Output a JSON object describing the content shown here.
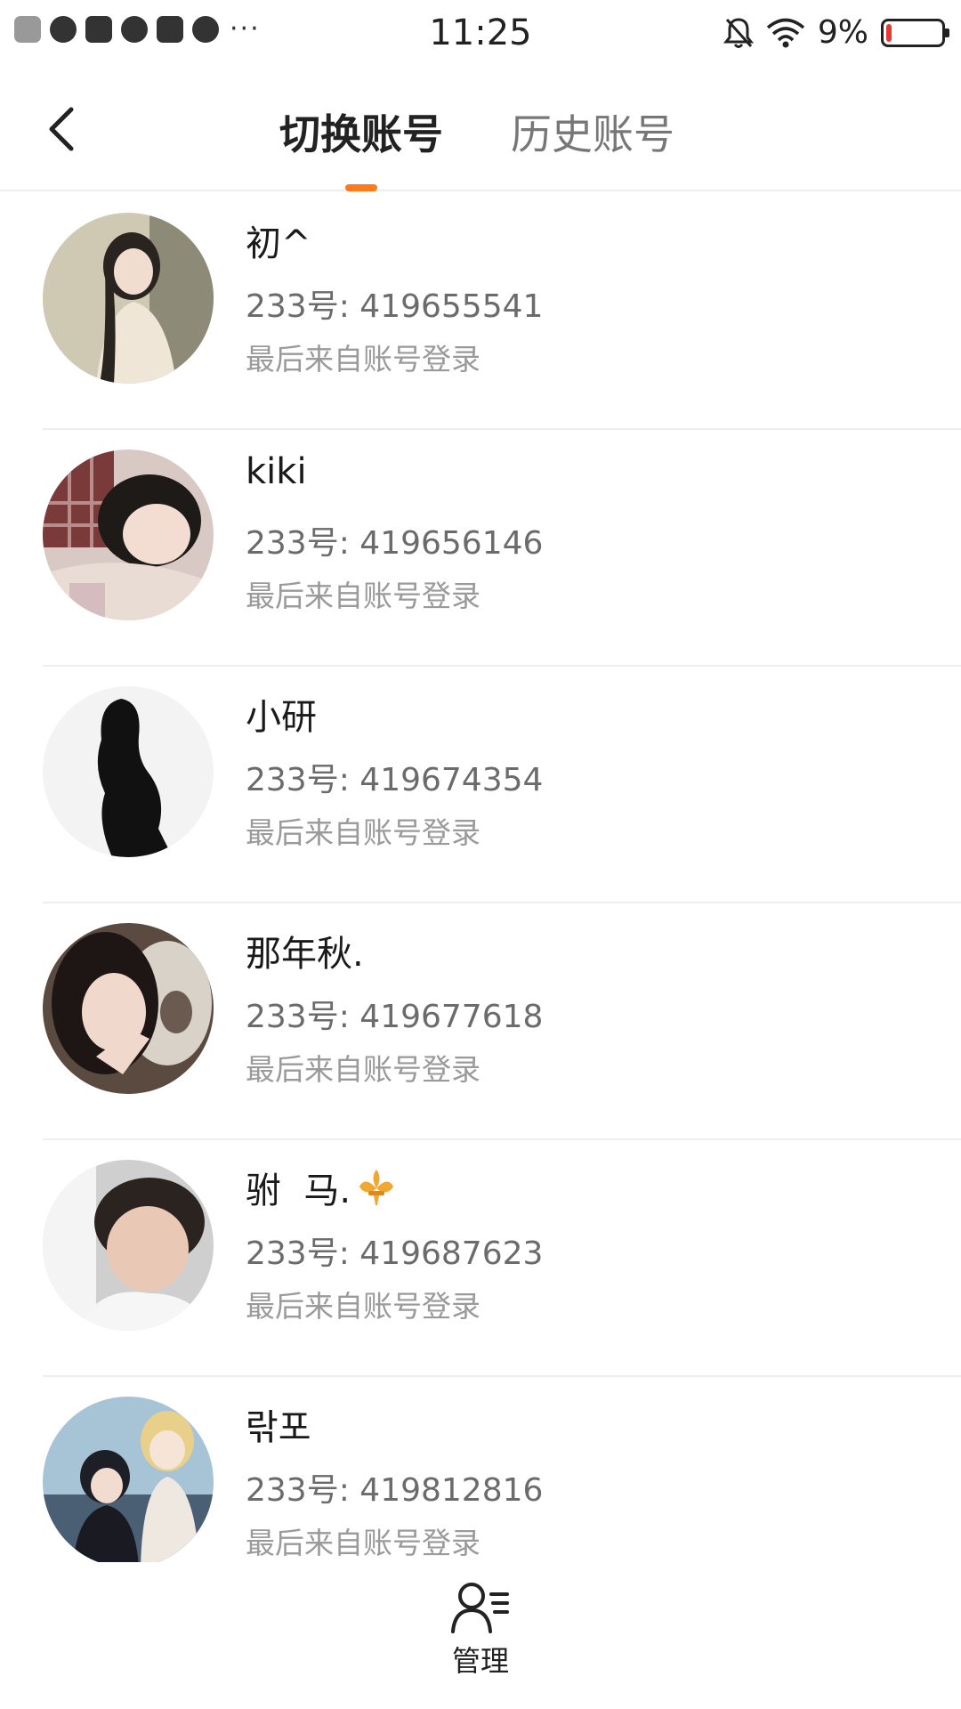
{
  "status_bar": {
    "time": "11:25",
    "battery_percent_text": "9%",
    "battery_level": 0.09,
    "battery_color": "#e53935",
    "icons_left": [
      "close-app-icon",
      "cloud-icon",
      "mail-icon",
      "pinwheel-icon",
      "play-icon",
      "planet-icon"
    ],
    "more": "···",
    "icons_right": [
      "bell-muted-icon",
      "wifi-icon",
      "battery-icon"
    ]
  },
  "header": {
    "back_icon": "chevron-left-icon",
    "tabs": [
      {
        "label": "切换账号",
        "active": true
      },
      {
        "label": "历史账号",
        "active": false
      }
    ],
    "accent_color": "#ff7a1a"
  },
  "accounts": [
    {
      "name": "初^",
      "id": "233号: 419655541",
      "login": "最后来自账号登录"
    },
    {
      "name": "kiki",
      "id": "233号: 419656146",
      "login": "最后来自账号登录"
    },
    {
      "name": "小研",
      "id": "233号: 419674354",
      "login": "最后来自账号登录"
    },
    {
      "name": "那年秋.",
      "id": "233号: 419677618",
      "login": "最后来自账号登录"
    },
    {
      "name": "驸  马.",
      "id": "233号: 419687623",
      "login": "最后来自账号登录",
      "badge_icon": "fleur-de-lis-icon"
    },
    {
      "name": "띾포",
      "id": "233号: 419812816",
      "login": "最后来自账号登录"
    }
  ],
  "bottom": {
    "manage_label": "管理",
    "manage_icon": "user-list-icon"
  }
}
